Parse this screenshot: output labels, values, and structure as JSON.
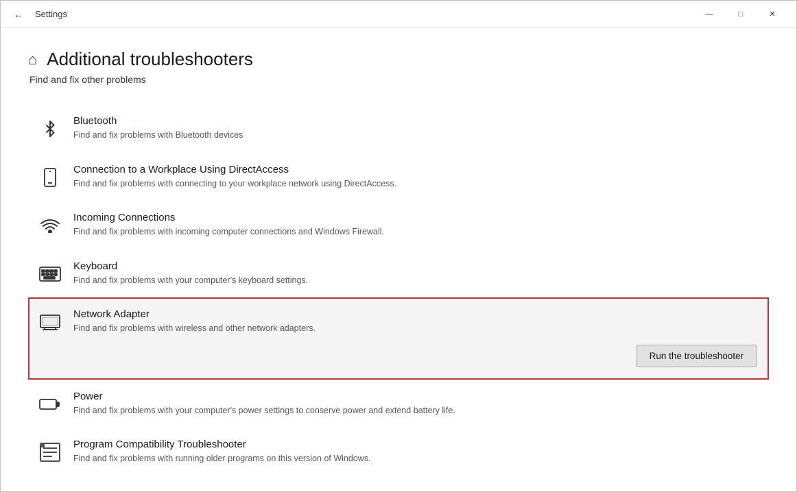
{
  "window": {
    "title": "Settings",
    "back_label": "←",
    "minimize_label": "—",
    "maximize_label": "□",
    "close_label": "✕"
  },
  "page": {
    "home_icon": "⌂",
    "title": "Additional troubleshooters",
    "subtitle": "Find and fix other problems"
  },
  "items": [
    {
      "id": "bluetooth",
      "title": "Bluetooth",
      "description": "Find and fix problems with Bluetooth devices",
      "icon": "bluetooth",
      "expanded": false
    },
    {
      "id": "directaccess",
      "title": "Connection to a Workplace Using DirectAccess",
      "description": "Find and fix problems with connecting to your workplace network using DirectAccess.",
      "icon": "phone",
      "expanded": false
    },
    {
      "id": "incoming",
      "title": "Incoming Connections",
      "description": "Find and fix problems with incoming computer connections and Windows Firewall.",
      "icon": "wifi",
      "expanded": false
    },
    {
      "id": "keyboard",
      "title": "Keyboard",
      "description": "Find and fix problems with your computer's keyboard settings.",
      "icon": "keyboard",
      "expanded": false
    },
    {
      "id": "network",
      "title": "Network Adapter",
      "description": "Find and fix problems with wireless and other network adapters.",
      "icon": "monitor",
      "expanded": true,
      "run_button_label": "Run the troubleshooter"
    },
    {
      "id": "power",
      "title": "Power",
      "description": "Find and fix problems with your computer's power settings to conserve power and extend battery life.",
      "icon": "battery",
      "expanded": false
    },
    {
      "id": "compatibility",
      "title": "Program Compatibility Troubleshooter",
      "description": "Find and fix problems with running older programs on this version of Windows.",
      "icon": "list",
      "expanded": false
    }
  ]
}
